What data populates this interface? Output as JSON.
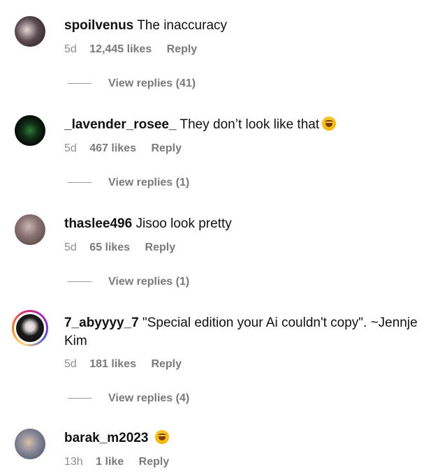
{
  "comments": [
    {
      "username": "spoilvenus",
      "text": "The inaccuracy",
      "time": "5d",
      "likes": "12,445 likes",
      "reply_label": "Reply",
      "view_replies": "View replies (41)",
      "avatar_color": "#2a2a2a",
      "emoji": false
    },
    {
      "username": "_lavender_rosee_",
      "text": "They don’t look like that",
      "time": "5d",
      "likes": "467 likes",
      "reply_label": "Reply",
      "view_replies": "View replies (1)",
      "avatar_color": "#0d1a10",
      "emoji": true
    },
    {
      "username": "thaslee496",
      "text": "Jisoo look pretty",
      "time": "5d",
      "likes": "65 likes",
      "reply_label": "Reply",
      "view_replies": "View replies (1)",
      "avatar_color": "#8a7a7a",
      "emoji": false
    },
    {
      "username": "7_abyyyy_7",
      "text": "\"Special edition your Ai couldn't copy\". ~Jennje Kim",
      "time": "5d",
      "likes": "181 likes",
      "reply_label": "Reply",
      "view_replies": "View replies (4)",
      "avatar_color": "#1c1c1c",
      "emoji": false
    },
    {
      "username": "barak_m2023",
      "text": "",
      "time": "13h",
      "likes": "1 like",
      "reply_label": "Reply",
      "avatar_color": "#6a7a8a",
      "emoji": true
    }
  ],
  "colors": {
    "meta_text": "#8e8e8e",
    "story_ring": [
      "#feda75",
      "#fa7e1e",
      "#d62976",
      "#962fbf",
      "#4f5bd5"
    ]
  }
}
